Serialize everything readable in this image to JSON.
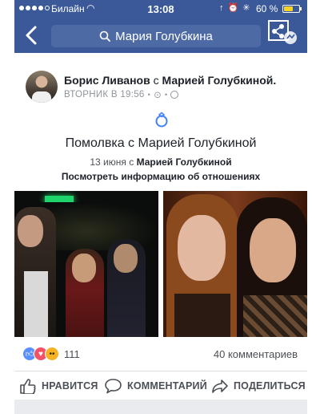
{
  "status_bar": {
    "carrier": "Билайн",
    "time": "13:08",
    "battery_percent": "60 %",
    "battery_level": 0.6
  },
  "nav": {
    "search_text": "Мария Голубкина"
  },
  "post": {
    "author": "Борис Ливанов",
    "with_word": "с",
    "tagged": "Марией Голубкиной.",
    "timestamp": "ВТОРНИК В 19:56",
    "event_title": "Помолвка с Марией Голубкиной",
    "event_date_prefix": "13 июня с",
    "event_date_name": "Марией Голубкиной",
    "event_link": "Посмотреть информацию об отношениях",
    "reaction_count": "111",
    "comments": "40 комментариев"
  },
  "actions": {
    "like": "НРАВИТСЯ",
    "comment": "КОММЕНТАРИЙ",
    "share": "ПОДЕЛИТЬСЯ"
  },
  "icons": {
    "back": "chevron-left-icon",
    "search": "search-icon",
    "share": "share-icon",
    "ring": "ring-icon",
    "globe": "globe-icon"
  },
  "colors": {
    "header": "#3b5998",
    "like": "#5890ff",
    "love": "#f25268",
    "wow": "#f7b125"
  }
}
